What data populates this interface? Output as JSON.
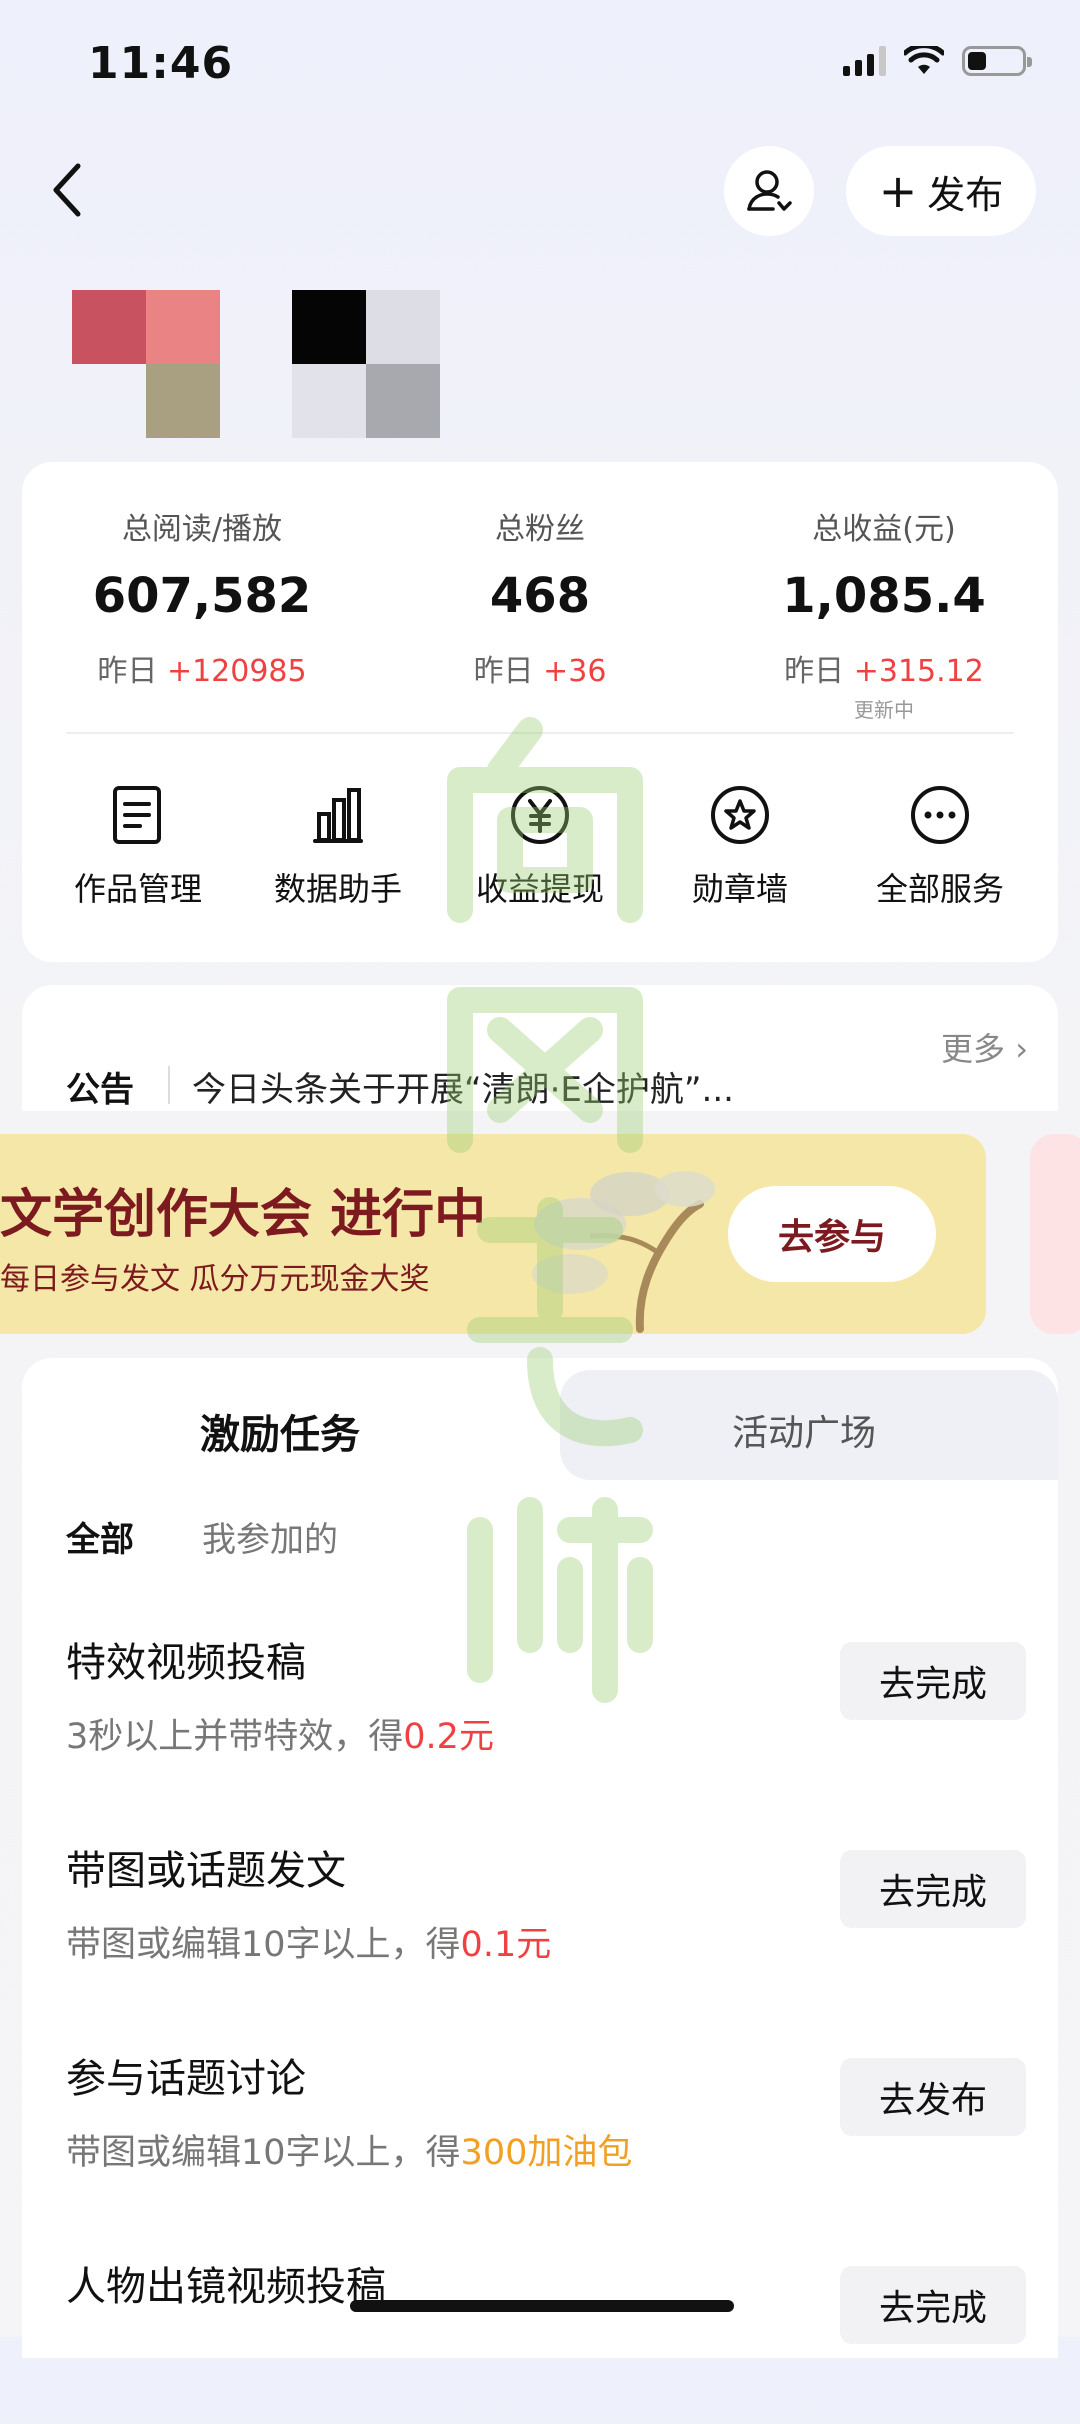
{
  "status": {
    "time": "11:46"
  },
  "header": {
    "publish_label": "发布"
  },
  "stats": [
    {
      "label": "总阅读/播放",
      "value": "607,582",
      "sub_prefix": "昨日",
      "sub_delta": "+120985"
    },
    {
      "label": "总粉丝",
      "value": "468",
      "sub_prefix": "昨日",
      "sub_delta": "+36"
    },
    {
      "label": "总收益(元)",
      "value": "1,085.4",
      "sub_prefix": "昨日",
      "sub_delta": "+315.12",
      "note": "更新中"
    }
  ],
  "services": [
    {
      "label": "作品管理",
      "icon": "document-icon"
    },
    {
      "label": "数据助手",
      "icon": "bar-chart-icon"
    },
    {
      "label": "收益提现",
      "icon": "yuan-coin-icon"
    },
    {
      "label": "勋章墙",
      "icon": "medal-star-icon"
    },
    {
      "label": "全部服务",
      "icon": "more-dots-icon"
    }
  ],
  "notice": {
    "label": "公告",
    "text": "今日头条关于开展“清朗·E企护航”...",
    "more": "更多"
  },
  "banner": {
    "title": "文学创作大会 进行中",
    "subtitle": "每日参与发文 瓜分万元现金大奖",
    "button": "去参与"
  },
  "tabs": {
    "active": "激励任务",
    "inactive": "活动广场"
  },
  "filters": {
    "all": "全部",
    "mine": "我参加的"
  },
  "tasks": [
    {
      "title": "特效视频投稿",
      "desc": "3秒以上并带特效，得",
      "reward": "0.2元",
      "reward_color": "#f04142",
      "button": "去完成"
    },
    {
      "title": "带图或话题发文",
      "desc": "带图或编辑10字以上，得",
      "reward": "0.1元",
      "reward_color": "#f04142",
      "button": "去完成"
    },
    {
      "title": "参与话题讨论",
      "desc": "带图或编辑10字以上，得",
      "reward": "300加油包",
      "reward_color": "#f2a024",
      "button": "去发布"
    },
    {
      "title": "人物出镜视频投稿",
      "desc": "",
      "reward": "",
      "reward_color": "#f04142",
      "button": "去完成"
    }
  ],
  "colors": {
    "accent_red": "#f04142",
    "accent_orange": "#f2a024",
    "banner_text": "#7d1a1f",
    "banner_bg": "#f4e7a8"
  }
}
